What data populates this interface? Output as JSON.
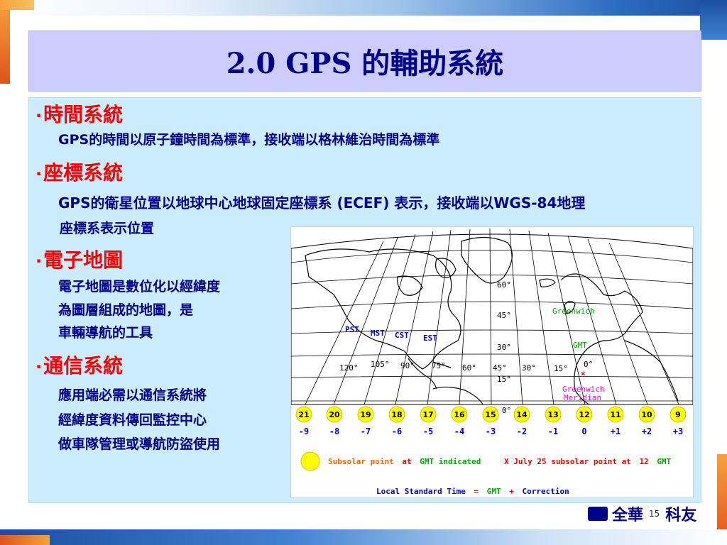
{
  "title": "2.0 GPS 的輔助系統",
  "sections": [
    {
      "heading": "時間系統",
      "lines": [
        "GPS的時間以原子鐘時間為標準，接收端以格林維治時間為標準"
      ]
    },
    {
      "heading": "座標系統",
      "lines": [
        "GPS的衛星位置以地球中心地球固定座標系 (ECEF) 表示，接收端以WGS-84地理",
        "座標系表示位置"
      ]
    },
    {
      "heading": "電子地圖",
      "lines": [
        "電子地圖是數位化以經緯度",
        "為圖層組成的地圖，是",
        "車輛導航的工具"
      ]
    },
    {
      "heading": "通信系統",
      "lines": [
        "應用端必需以通信系統將",
        "經緯度資料傳回監控中心",
        "做車隊管理或導航防盜使用"
      ]
    }
  ],
  "map": {
    "lat_labels": [
      "60°",
      "45°",
      "30°",
      "15°",
      "0°"
    ],
    "lon_labels": [
      "120°",
      "105°",
      "90°",
      "75°",
      "60°",
      "45°",
      "30°",
      "15°",
      "0°"
    ],
    "zone_labels": [
      "PST",
      "MST",
      "CST",
      "EST"
    ],
    "greenwich_label": "Greenwich",
    "gmt_label": "GMT",
    "greenwich_meridian": [
      "Greenwich",
      "Meridian"
    ],
    "circles": [
      "21",
      "20",
      "19",
      "18",
      "17",
      "16",
      "15",
      "14",
      "13",
      "12",
      "11",
      "10",
      "9"
    ],
    "offsets": [
      "-9",
      "-8",
      "-7",
      "-6",
      "-5",
      "-4",
      "-3",
      "-2",
      "-1",
      "0",
      "+1",
      "+2",
      "+3"
    ],
    "legend": {
      "subsolar_a": "Subsolar point",
      "subsolar_b": "at",
      "subsolar_c": "GMT indicated",
      "july_a": "X July 25 subsolar point at",
      "july_b": "12",
      "july_c": "GMT",
      "local_a": "Local Standard Time",
      "local_b": "=",
      "local_c": "GMT",
      "local_d": "+",
      "local_e": "Correction"
    },
    "colors": {
      "circle": "#ffff00",
      "offset": "#0000cc",
      "legend_orange": "#ff6600",
      "legend_green": "#00aa00",
      "legend_red": "#ff0000",
      "legend_blue": "#0000cc",
      "greenwich_magenta": "#ff00ff"
    }
  },
  "footer": {
    "logo_left": "全華",
    "page": "15",
    "logo_right": "科友"
  }
}
